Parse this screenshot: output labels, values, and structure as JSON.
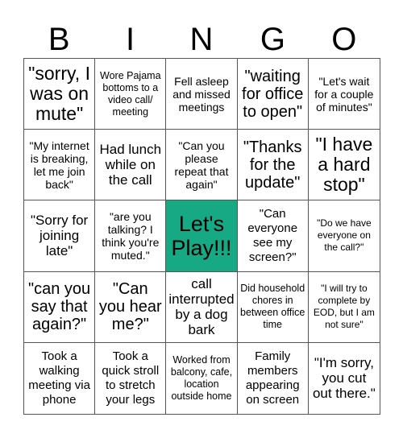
{
  "header": {
    "letters": [
      "B",
      "I",
      "N",
      "G",
      "O"
    ]
  },
  "free_space": {
    "label": "Let's Play!!!",
    "color": "#17a884"
  },
  "cells": [
    "\"sorry, I was on mute\"",
    "Wore Pajama bottoms to a video call/ meeting",
    "Fell asleep and missed meetings",
    "\"waiting for office to open\"",
    "\"Let's wait for a couple of minutes\"",
    "\"My internet is breaking, let me join back\"",
    "Had lunch while on the call",
    "\"Can you please repeat that again\"",
    "\"Thanks for the update\"",
    "\"I have a hard stop\"",
    "\"Sorry for joining late\"",
    "\"are you talking? I think you're muted.\"",
    "Let's Play!!!",
    "\"Can everyone see my screen?\"",
    "\"Do we have everyone on the call?\"",
    "\"can you say that again?\"",
    "\"Can you hear me?\"",
    "call interrupted by a dog bark",
    "Did household chores in between office time",
    "\"I will try to complete by EOD, but I am not sure\"",
    "Took a walking meeting via phone",
    "Took a quick stroll to stretch your legs",
    "Worked from balcony, cafe, location outside home",
    "Family members appearing on screen",
    "\"I'm sorry, you cut out there.\""
  ]
}
